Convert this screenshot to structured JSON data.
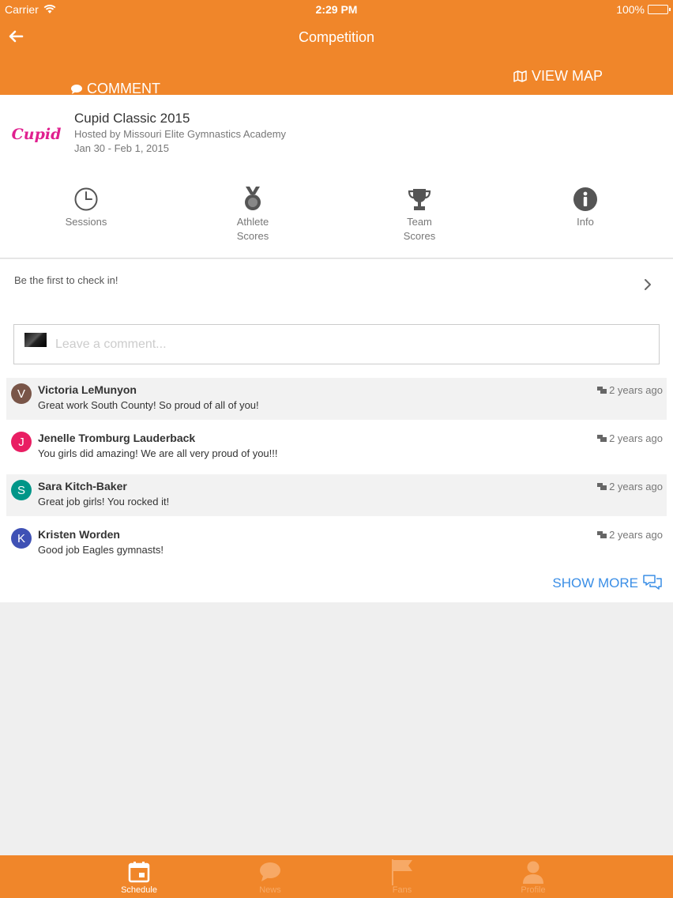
{
  "status_bar": {
    "carrier": "Carrier",
    "time": "2:29 PM",
    "battery": "100%"
  },
  "nav": {
    "title": "Competition"
  },
  "actions": {
    "comment": "COMMENT",
    "view_map": "VIEW MAP"
  },
  "competition": {
    "logo_text": "Cupid",
    "name": "Cupid Classic 2015",
    "host": "Hosted by Missouri Elite Gymnastics Academy",
    "dates": "Jan 30 - Feb 1, 2015",
    "tabs": [
      {
        "label": "Sessions",
        "icon": "clock-icon"
      },
      {
        "label": "Athlete\nScores",
        "icon": "medal-icon"
      },
      {
        "label": "Team\nScores",
        "icon": "trophy-icon"
      },
      {
        "label": "Info",
        "icon": "info-icon"
      }
    ]
  },
  "checkin": {
    "text": "Be the first to check in!"
  },
  "comment_input": {
    "placeholder": "Leave a comment..."
  },
  "comments": [
    {
      "initial": "V",
      "name": "Victoria LeMunyon",
      "text": "Great work South County! So proud of all of you!",
      "time": "2 years ago",
      "color": "#795548"
    },
    {
      "initial": "J",
      "name": "Jenelle Tromburg Lauderback",
      "text": "You girls did amazing! We are all very proud of you!!!",
      "time": "2 years ago",
      "color": "#e91e63"
    },
    {
      "initial": "S",
      "name": "Sara Kitch-Baker",
      "text": "Great job girls! You rocked it!",
      "time": "2 years ago",
      "color": "#009688"
    },
    {
      "initial": "K",
      "name": "Kristen Worden",
      "text": "Good job Eagles gymnasts!",
      "time": "2 years ago",
      "color": "#3f51b5"
    }
  ],
  "show_more": "SHOW MORE",
  "tab_bar": [
    {
      "label": "Schedule",
      "icon": "calendar-icon",
      "active": true
    },
    {
      "label": "News",
      "icon": "chat-bubble-icon",
      "active": false
    },
    {
      "label": "Fans",
      "icon": "flag-icon",
      "active": false
    },
    {
      "label": "Profile",
      "icon": "person-icon",
      "active": false
    }
  ],
  "colors": {
    "brand": "#f0862a",
    "link": "#3a8ee6"
  }
}
